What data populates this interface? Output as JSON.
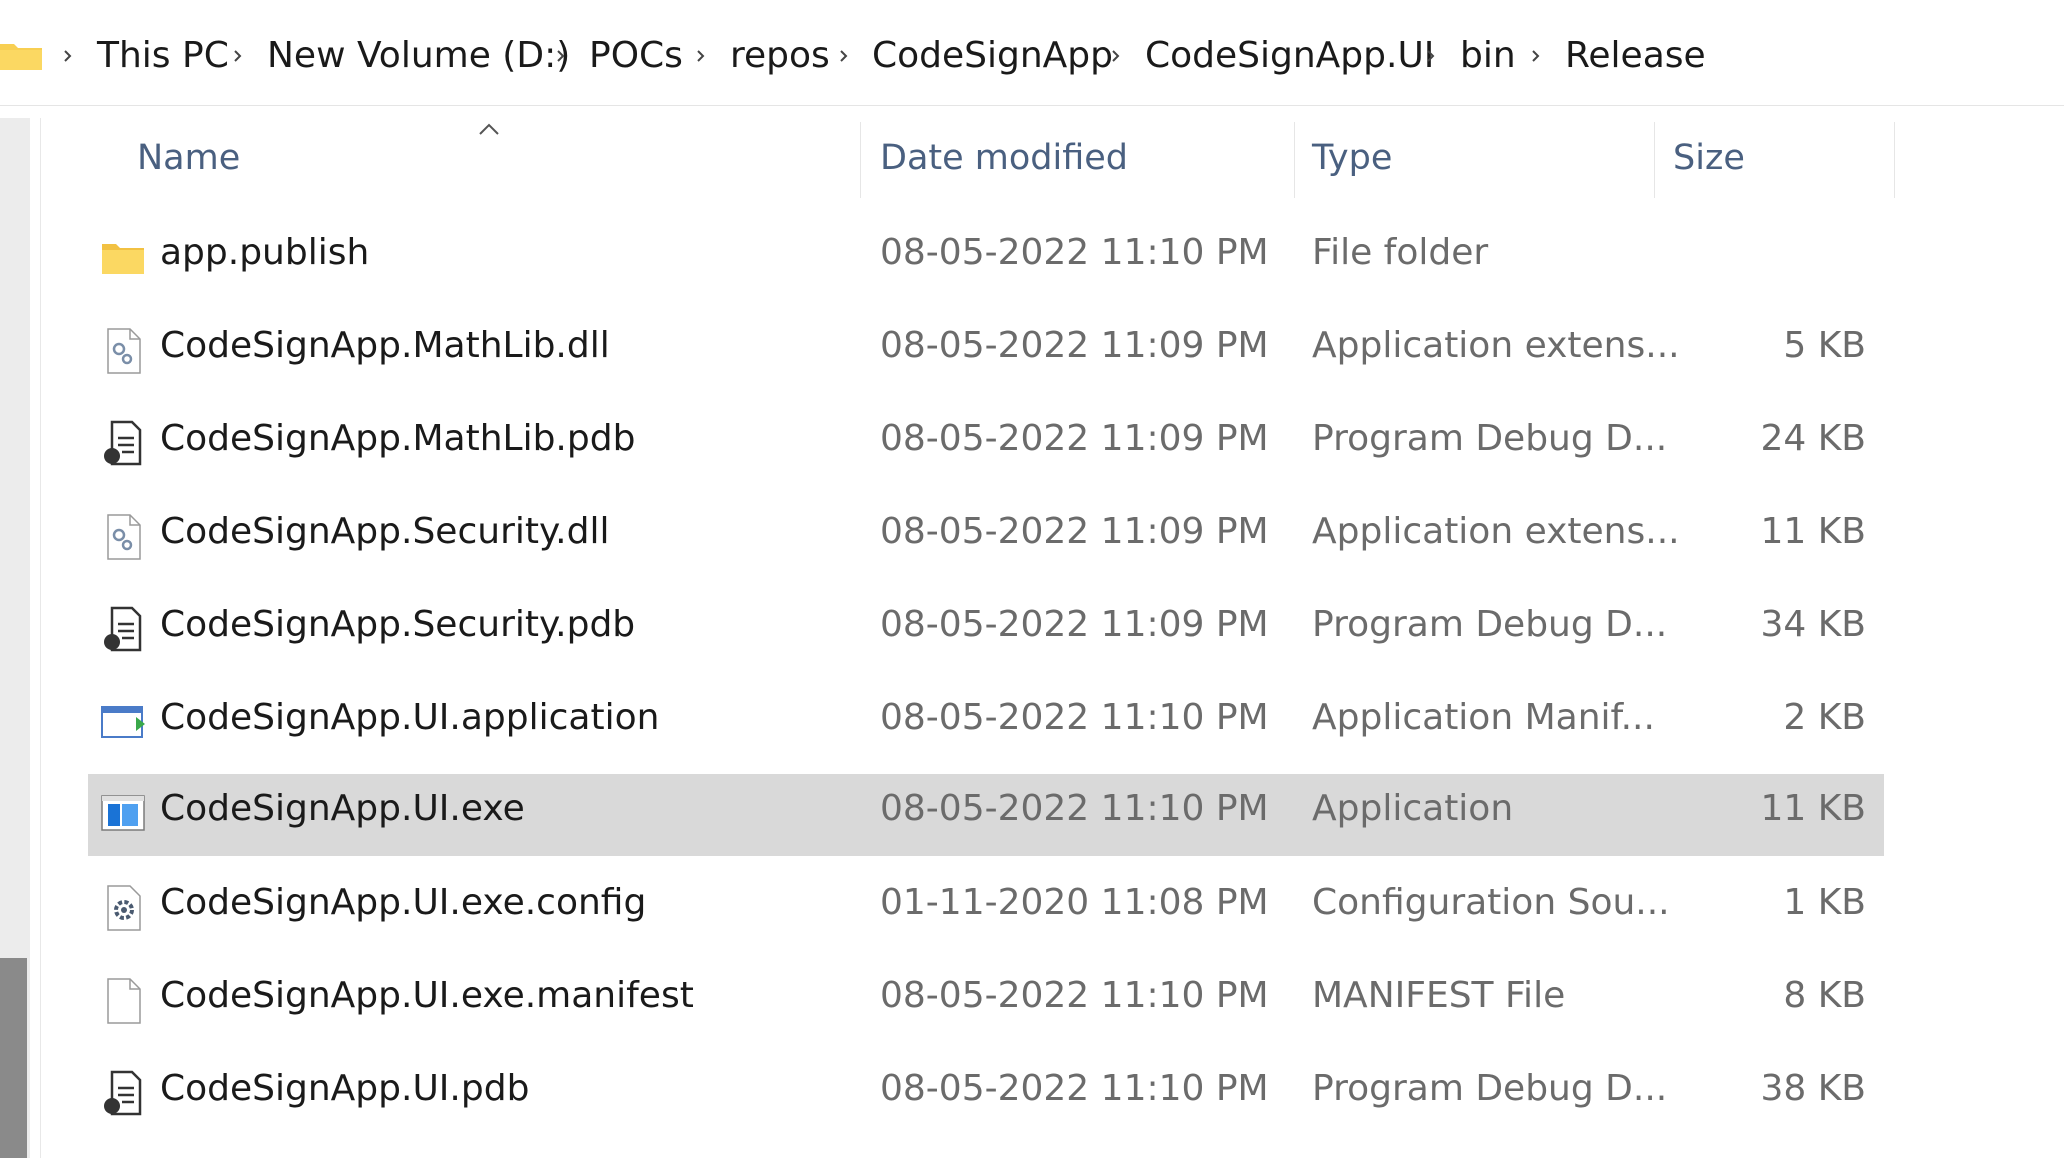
{
  "breadcrumb": [
    {
      "label": "This PC"
    },
    {
      "label": "New Volume (D:)"
    },
    {
      "label": "POCs"
    },
    {
      "label": "repos"
    },
    {
      "label": "CodeSignApp"
    },
    {
      "label": "CodeSignApp.UI"
    },
    {
      "label": "bin"
    },
    {
      "label": "Release"
    }
  ],
  "columns": {
    "name": "Name",
    "date": "Date modified",
    "type": "Type",
    "size": "Size"
  },
  "files": [
    {
      "name": "app.publish",
      "date": "08-05-2022 11:10 PM",
      "type": "File folder",
      "size": "",
      "icon": "folder-icon",
      "selected": false
    },
    {
      "name": "CodeSignApp.MathLib.dll",
      "date": "08-05-2022 11:09 PM",
      "type": "Application extens...",
      "size": "5 KB",
      "icon": "dll-file-icon",
      "selected": false
    },
    {
      "name": "CodeSignApp.MathLib.pdb",
      "date": "08-05-2022 11:09 PM",
      "type": "Program Debug D...",
      "size": "24 KB",
      "icon": "pdb-file-icon",
      "selected": false
    },
    {
      "name": "CodeSignApp.Security.dll",
      "date": "08-05-2022 11:09 PM",
      "type": "Application extens...",
      "size": "11 KB",
      "icon": "dll-file-icon",
      "selected": false
    },
    {
      "name": "CodeSignApp.Security.pdb",
      "date": "08-05-2022 11:09 PM",
      "type": "Program Debug D...",
      "size": "34 KB",
      "icon": "pdb-file-icon",
      "selected": false
    },
    {
      "name": "CodeSignApp.UI.application",
      "date": "08-05-2022 11:10 PM",
      "type": "Application Manif...",
      "size": "2 KB",
      "icon": "application-manifest-icon",
      "selected": false
    },
    {
      "name": "CodeSignApp.UI.exe",
      "date": "08-05-2022 11:10 PM",
      "type": "Application",
      "size": "11 KB",
      "icon": "exe-file-icon",
      "selected": true
    },
    {
      "name": "CodeSignApp.UI.exe.config",
      "date": "01-11-2020 11:08 PM",
      "type": "Configuration Sou...",
      "size": "1 KB",
      "icon": "config-file-icon",
      "selected": false
    },
    {
      "name": "CodeSignApp.UI.exe.manifest",
      "date": "08-05-2022 11:10 PM",
      "type": "MANIFEST File",
      "size": "8 KB",
      "icon": "blank-file-icon",
      "selected": false
    },
    {
      "name": "CodeSignApp.UI.pdb",
      "date": "08-05-2022 11:10 PM",
      "type": "Program Debug D...",
      "size": "38 KB",
      "icon": "pdb-file-icon",
      "selected": false
    }
  ],
  "colors": {
    "selected_row": "#d9d9d9",
    "header_text": "#4a6080",
    "folder_yellow": "#f8cf52",
    "exe_blue": "#1a73d6",
    "manifest_green": "#3aa84a"
  }
}
